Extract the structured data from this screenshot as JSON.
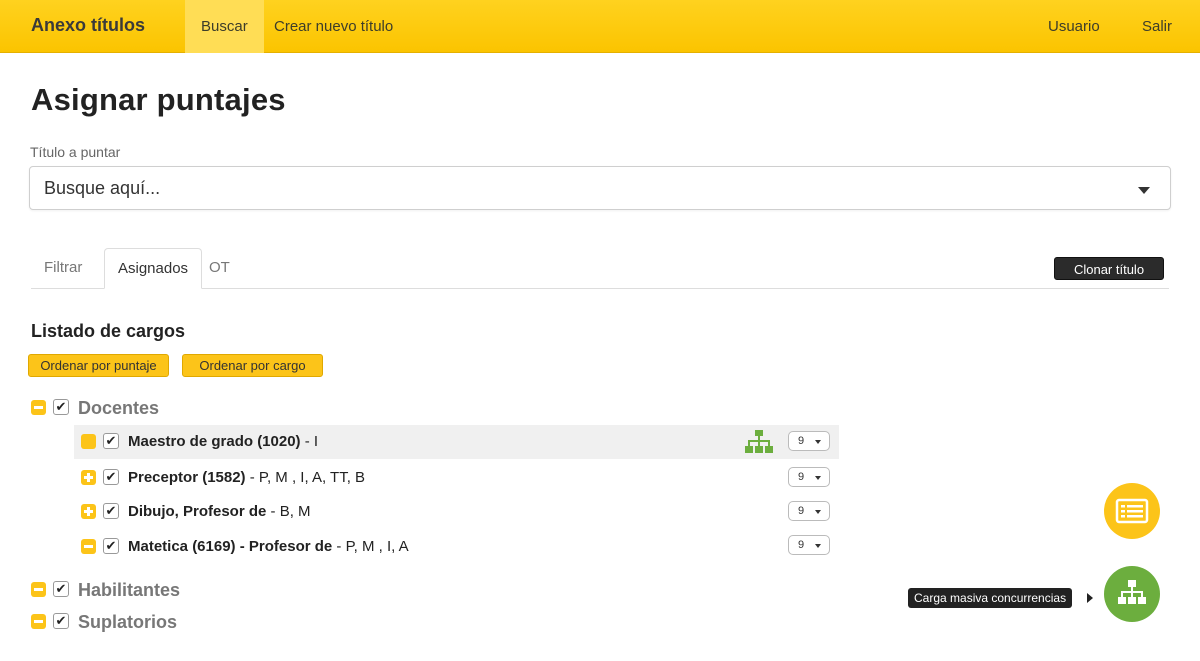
{
  "navbar": {
    "brand": "Anexo títulos",
    "items": [
      {
        "label": "Buscar",
        "active": true
      },
      {
        "label": "Crear nuevo título",
        "active": false
      }
    ],
    "right_items": [
      {
        "label": "Usuario"
      },
      {
        "label": "Salir"
      }
    ],
    "colors": {
      "bar": "#fcc419",
      "active": "#ffdd55"
    }
  },
  "page": {
    "title": "Asignar puntajes",
    "field_label": "Título a puntar",
    "select_placeholder": "Busque aquí..."
  },
  "tabs": {
    "items": [
      {
        "label": "Filtrar",
        "active": false
      },
      {
        "label": "Asignados",
        "active": true
      },
      {
        "label": "OT",
        "active": false
      }
    ],
    "clone_label": "Clonar título"
  },
  "list": {
    "title": "Listado de cargos",
    "order_by_score": "Ordenar por puntaje",
    "order_by_cargo": "Ordenar por cargo",
    "groups": [
      {
        "label": "Docentes",
        "toggle": "minus",
        "checked": true,
        "rows": [
          {
            "name": "Maestro de grado (1020)",
            "suffix": " - I",
            "toggle": "blank",
            "checked": true,
            "value": "9",
            "tree_icon": "sitemap-icon",
            "highlighted": true
          },
          {
            "name": "Preceptor (1582)",
            "suffix": " - P, M , I, A, TT, B",
            "toggle": "plus",
            "checked": true,
            "value": "9"
          },
          {
            "name": "Dibujo, Profesor de",
            "suffix": " - B, M",
            "toggle": "plus",
            "checked": true,
            "value": "9"
          },
          {
            "name": "Matetica (6169) - Profesor de",
            "suffix": " - P, M , I, A",
            "toggle": "minus",
            "checked": true,
            "value": "9"
          }
        ]
      },
      {
        "label": "Habilitantes",
        "toggle": "minus",
        "checked": true,
        "rows": []
      },
      {
        "label": "Suplatorios",
        "toggle": "minus",
        "checked": true,
        "rows": []
      }
    ]
  },
  "fab": {
    "list_icon": "list-icon",
    "tree_icon": "sitemap-icon",
    "tooltip": "Carga masiva concurrencias",
    "colors": {
      "yellow": "#fcc419",
      "green": "#6cae3e"
    }
  }
}
